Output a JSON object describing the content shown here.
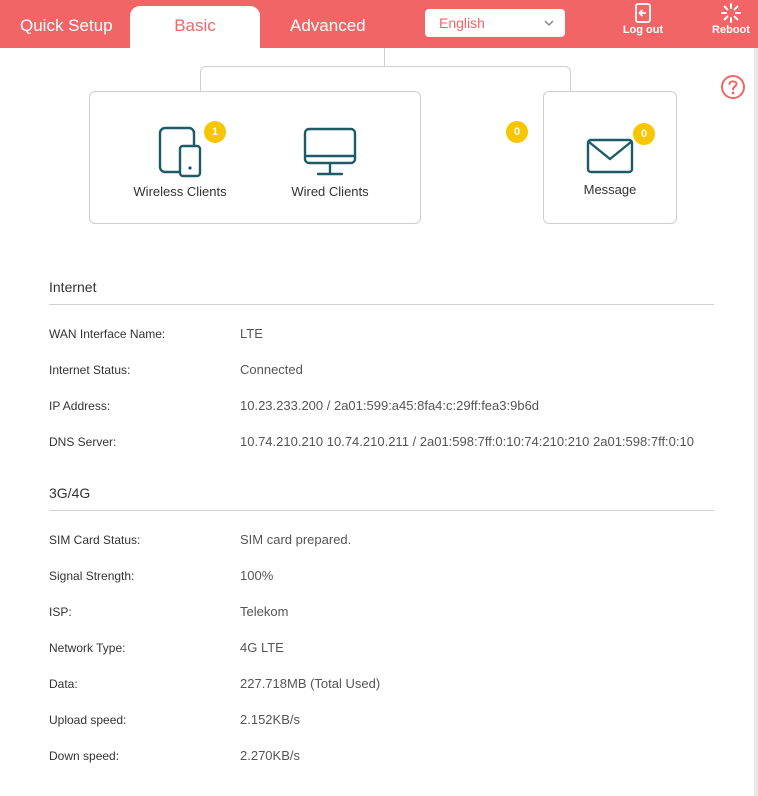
{
  "nav": {
    "quick_setup": "Quick Setup",
    "basic": "Basic",
    "advanced": "Advanced",
    "language": "English",
    "logout": "Log out",
    "reboot": "Reboot"
  },
  "colors": {
    "accent": "#f26566",
    "badge": "#f7c600",
    "icon": "#1d5b66"
  },
  "network_map": {
    "wireless_clients": {
      "label": "Wireless Clients",
      "count": "1",
      "icon": "tablet-phone-icon"
    },
    "wired_clients": {
      "label": "Wired Clients",
      "count": "0",
      "icon": "monitor-icon"
    },
    "message": {
      "label": "Message",
      "count": "0",
      "icon": "envelope-icon"
    }
  },
  "internet": {
    "title": "Internet",
    "rows": [
      {
        "label": "WAN Interface Name:",
        "value": "LTE"
      },
      {
        "label": "Internet Status:",
        "value": "Connected"
      },
      {
        "label": "IP Address:",
        "value": "10.23.233.200 / 2a01:599:a45:8fa4:c:29ff:fea3:9b6d"
      },
      {
        "label": "DNS Server:",
        "value": "10.74.210.210 10.74.210.211 / 2a01:598:7ff:0:10:74:210:210 2a01:598:7ff:0:10"
      }
    ]
  },
  "mobile": {
    "title": "3G/4G",
    "rows": [
      {
        "label": "SIM Card Status:",
        "value": "SIM card prepared."
      },
      {
        "label": "Signal Strength:",
        "value": "100%"
      },
      {
        "label": "ISP:",
        "value": "Telekom"
      },
      {
        "label": "Network Type:",
        "value": "4G LTE"
      },
      {
        "label": "Data:",
        "value": "227.718MB (Total Used)"
      },
      {
        "label": "Upload speed:",
        "value": "2.152KB/s"
      },
      {
        "label": "Down speed:",
        "value": "2.270KB/s"
      }
    ]
  }
}
